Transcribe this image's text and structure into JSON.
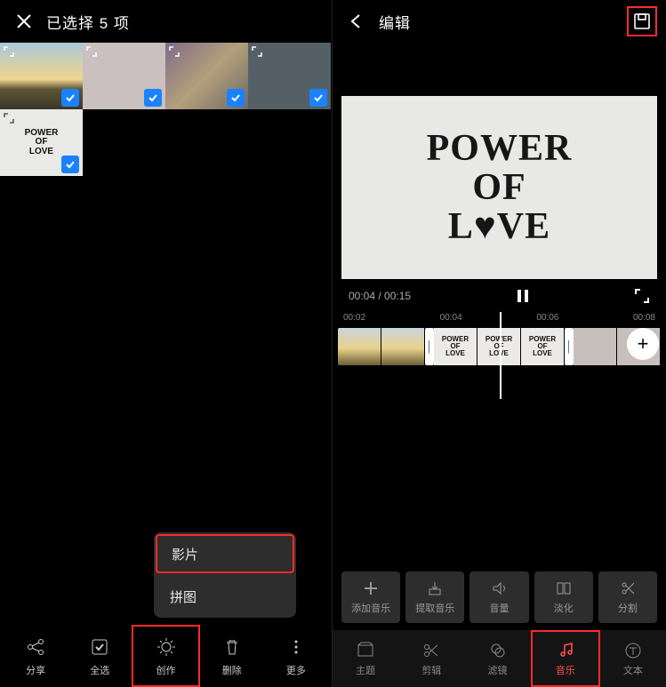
{
  "left": {
    "title": "已选择 5 项",
    "thumbs": [
      {
        "kind": "sunset",
        "text": ""
      },
      {
        "kind": "note",
        "text": ""
      },
      {
        "kind": "mic1",
        "text": ""
      },
      {
        "kind": "mic2",
        "text": ""
      },
      {
        "kind": "pol",
        "text": "POWER\nOF\nLOVE"
      }
    ],
    "popup": {
      "movie": "影片",
      "collage": "拼图"
    },
    "bottom": {
      "share": "分享",
      "selectall": "全选",
      "create": "创作",
      "delete": "删除",
      "more": "更多"
    }
  },
  "right": {
    "title": "编辑",
    "preview_text": "POWER\nOF\nL♥VE",
    "time_current": "00:04",
    "time_total": "00:15",
    "ruler": [
      "00:02",
      "00:04",
      "00:06",
      "00:08"
    ],
    "tools": {
      "add": "添加音乐",
      "extract": "提取音乐",
      "volume": "音量",
      "fade": "淡化",
      "split": "分割"
    },
    "tabs": {
      "theme": "主题",
      "cut": "剪辑",
      "filter": "滤镜",
      "music": "音乐",
      "text": "文本"
    }
  }
}
